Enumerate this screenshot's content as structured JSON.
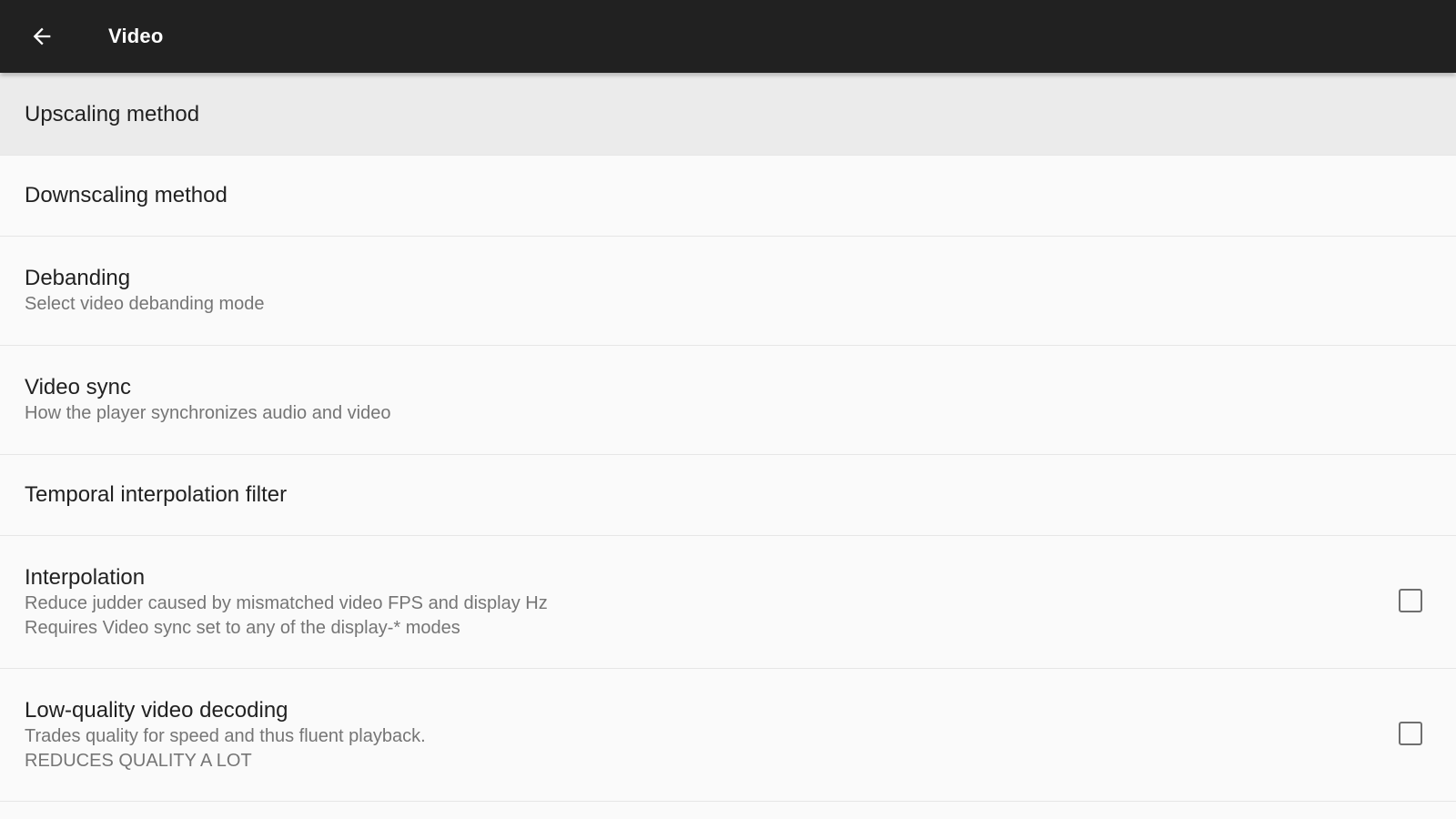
{
  "appbar": {
    "title": "Video",
    "back_icon": "arrow-left-icon"
  },
  "preferences": [
    {
      "title": "Upscaling method",
      "selected": true
    },
    {
      "title": "Downscaling method"
    },
    {
      "title": "Debanding",
      "summary": "Select video debanding mode"
    },
    {
      "title": "Video sync",
      "summary": "How the player synchronizes audio and video"
    },
    {
      "title": "Temporal interpolation filter"
    },
    {
      "title": "Interpolation",
      "summary_lines": [
        "Reduce judder caused by mismatched video FPS and display Hz",
        "Requires Video sync set to any of the display-* modes"
      ],
      "checked": false
    },
    {
      "title": "Low-quality video decoding",
      "summary_lines": [
        "Trades quality for speed and thus fluent playback.",
        "REDUCES QUALITY A LOT"
      ],
      "checked": false
    }
  ]
}
